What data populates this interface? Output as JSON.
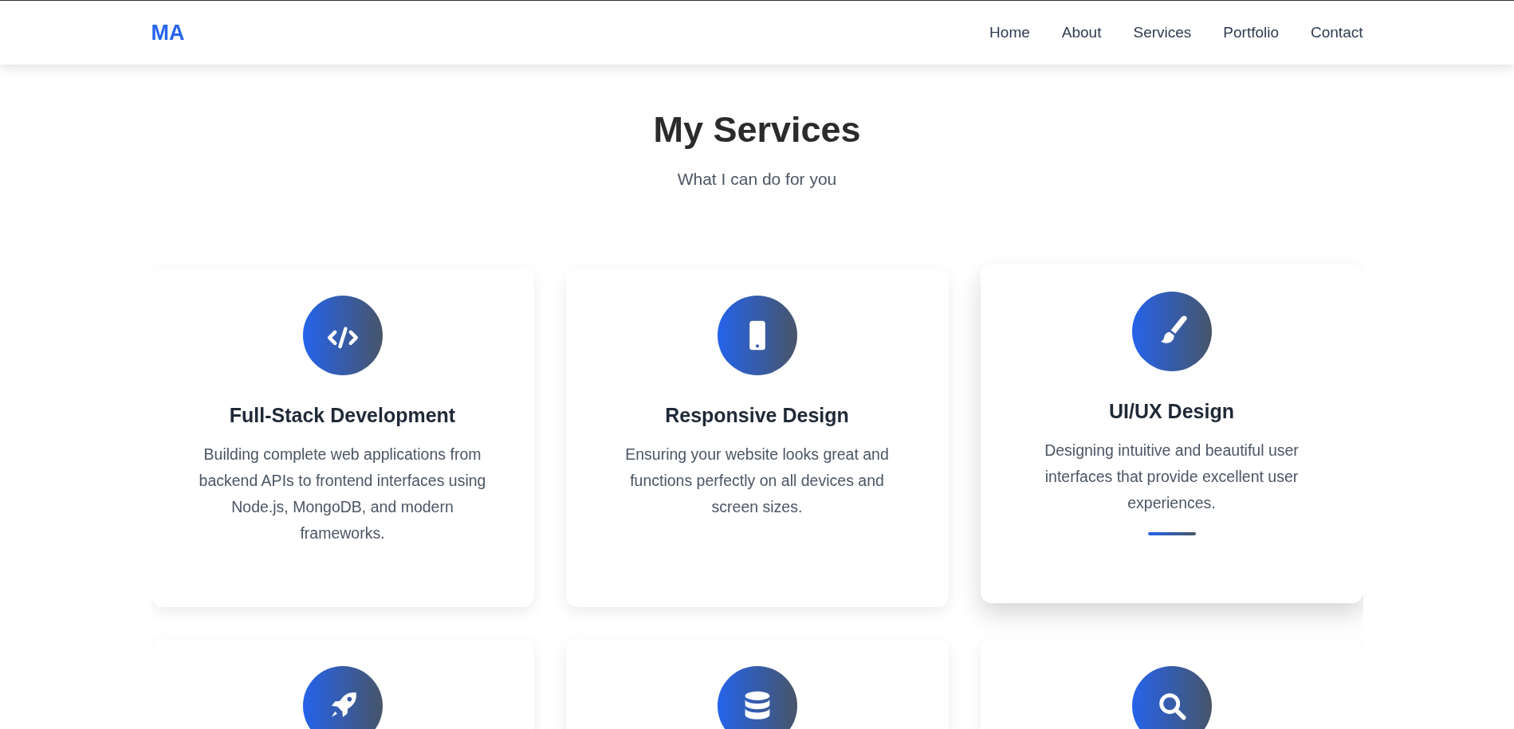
{
  "navbar": {
    "logo": "MA",
    "links": [
      {
        "label": "Home"
      },
      {
        "label": "About"
      },
      {
        "label": "Services"
      },
      {
        "label": "Portfolio"
      },
      {
        "label": "Contact"
      }
    ]
  },
  "section": {
    "title": "My Services",
    "subtitle": "What I can do for you"
  },
  "services": [
    {
      "title": "Full-Stack Development",
      "description": "Building complete web applications from backend APIs to frontend interfaces using Node.js, MongoDB, and modern frameworks.",
      "highlighted": false
    },
    {
      "title": "Responsive Design",
      "description": "Ensuring your website looks great and functions perfectly on all devices and screen sizes.",
      "highlighted": false
    },
    {
      "title": "UI/UX Design",
      "description": "Designing intuitive and beautiful user interfaces that provide excellent user experiences.",
      "highlighted": true
    },
    {
      "highlighted": false
    },
    {
      "highlighted": false
    },
    {
      "highlighted": false
    }
  ]
}
